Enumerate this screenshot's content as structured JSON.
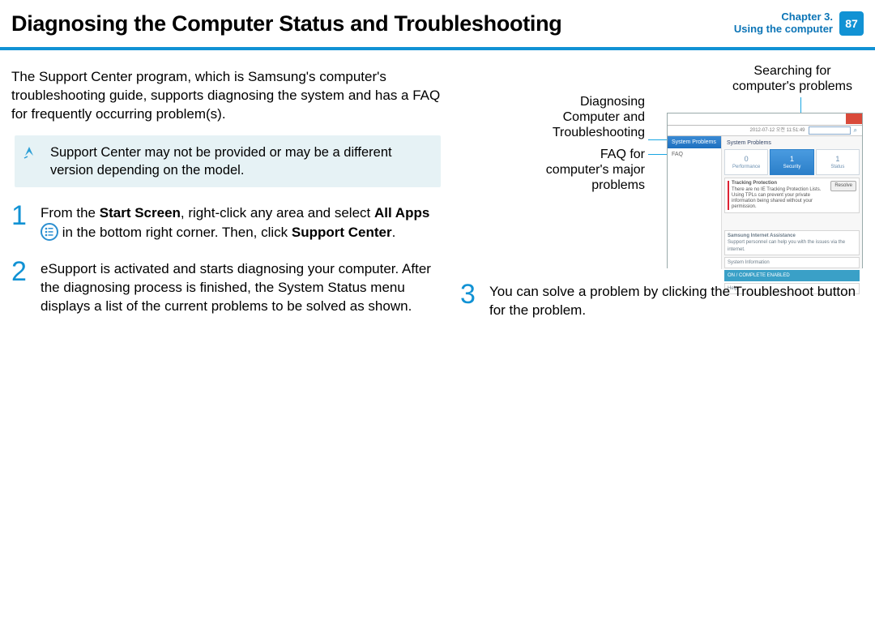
{
  "header": {
    "title": "Diagnosing the Computer Status and Troubleshooting",
    "chapter_line1": "Chapter 3.",
    "chapter_line2": "Using the computer",
    "page_number": "87"
  },
  "intro": "The Support Center program, which is Samsung's computer's troubleshooting guide, supports diagnosing the system and has a FAQ for frequently occurring problem(s).",
  "note": "Support Center may not be provided or may be a different version depending on the model.",
  "steps": {
    "n1": "1",
    "s1a": "From the ",
    "s1b": "Start Screen",
    "s1c": ", right-click any area and select ",
    "s1d": "All Apps",
    "s1e": " in the bottom right corner. Then, click ",
    "s1f": "Support Center",
    "s1g": ".",
    "n2": "2",
    "s2": "eSupport is activated and starts diagnosing your computer. After the diagnosing process is finished, the System Status menu displays a list of the current problems to be solved as shown.",
    "n3": "3",
    "s3": "You can solve a problem by clicking the Troubleshoot button for the problem."
  },
  "annotations": {
    "search": "Searching for computer's problems",
    "diag": "Diagnosing Computer and Troubleshooting",
    "faq": "FAQ for computer's major problems"
  },
  "screenshot": {
    "sidebar_sel": "System Problems",
    "sidebar_faq": "FAQ",
    "crumb": "System Problems",
    "date": "2012-07-12 오전 11:51:49",
    "tile_perf": "Performance",
    "tile_perf_n": "0",
    "tile_sec": "Security",
    "tile_sec_n": "1",
    "tile_stat": "Status",
    "tile_stat_n": "1",
    "issue_title": "Tracking Protection",
    "issue_body": "There are no IE Tracking Protection Lists. Using TPLs can prevent your private information being shared without your permission.",
    "issue_btn": "Resolve",
    "box1a": "Samsung Internet Assistance",
    "box1b": "Support personnel can help you with the issues via the internet.",
    "box2": "System Information",
    "box3": "ON / COMPLETE ENABLED",
    "box4": "Help"
  }
}
